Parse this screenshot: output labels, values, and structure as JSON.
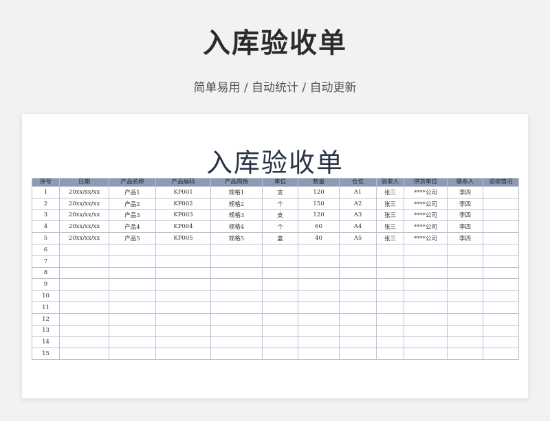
{
  "header": {
    "title": "入库验收单",
    "subtitle": "简单易用 / 自动统计 / 自动更新"
  },
  "sheet": {
    "title": "入库验收单",
    "columns": [
      "序号",
      "日期",
      "产品名称",
      "产品编码",
      "产品规格",
      "单位",
      "数量",
      "仓位",
      "验收人",
      "供货单位",
      "联系人",
      "验收情况"
    ],
    "rows": [
      [
        "1",
        "20xx/xx/xx",
        "产品1",
        "KP001",
        "规格1",
        "支",
        "120",
        "A1",
        "张三",
        "****公司",
        "李四",
        ""
      ],
      [
        "2",
        "20xx/xx/xx",
        "产品2",
        "KP002",
        "规格2",
        "个",
        "150",
        "A2",
        "张三",
        "****公司",
        "李四",
        ""
      ],
      [
        "3",
        "20xx/xx/xx",
        "产品3",
        "KP003",
        "规格3",
        "支",
        "120",
        "A3",
        "张三",
        "****公司",
        "李四",
        ""
      ],
      [
        "4",
        "20xx/xx/xx",
        "产品4",
        "KP004",
        "规格4",
        "个",
        "60",
        "A4",
        "张三",
        "****公司",
        "李四",
        ""
      ],
      [
        "5",
        "20xx/xx/xx",
        "产品5",
        "KP005",
        "规格5",
        "盒",
        "40",
        "A5",
        "张三",
        "****公司",
        "李四",
        ""
      ],
      [
        "6",
        "",
        "",
        "",
        "",
        "",
        "",
        "",
        "",
        "",
        "",
        ""
      ],
      [
        "7",
        "",
        "",
        "",
        "",
        "",
        "",
        "",
        "",
        "",
        "",
        ""
      ],
      [
        "8",
        "",
        "",
        "",
        "",
        "",
        "",
        "",
        "",
        "",
        "",
        ""
      ],
      [
        "9",
        "",
        "",
        "",
        "",
        "",
        "",
        "",
        "",
        "",
        "",
        ""
      ],
      [
        "10",
        "",
        "",
        "",
        "",
        "",
        "",
        "",
        "",
        "",
        "",
        ""
      ],
      [
        "11",
        "",
        "",
        "",
        "",
        "",
        "",
        "",
        "",
        "",
        "",
        ""
      ],
      [
        "12",
        "",
        "",
        "",
        "",
        "",
        "",
        "",
        "",
        "",
        "",
        ""
      ],
      [
        "13",
        "",
        "",
        "",
        "",
        "",
        "",
        "",
        "",
        "",
        "",
        ""
      ],
      [
        "14",
        "",
        "",
        "",
        "",
        "",
        "",
        "",
        "",
        "",
        "",
        ""
      ],
      [
        "15",
        "",
        "",
        "",
        "",
        "",
        "",
        "",
        "",
        "",
        "",
        ""
      ]
    ]
  }
}
